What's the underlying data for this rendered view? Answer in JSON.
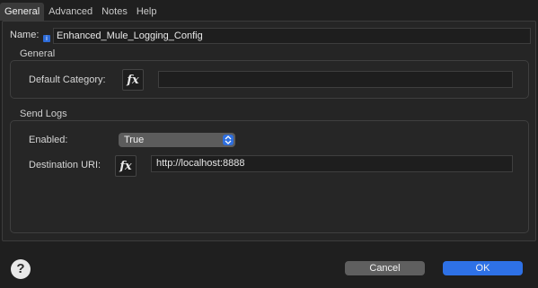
{
  "tabs": [
    {
      "label": "General"
    },
    {
      "label": "Advanced"
    },
    {
      "label": "Notes"
    },
    {
      "label": "Help"
    }
  ],
  "name": {
    "label": "Name:",
    "value": "Enhanced_Mule_Logging_Config",
    "info_icon": "info-icon"
  },
  "general_group": {
    "title": "General",
    "default_category": {
      "label": "Default Category:",
      "fx_label": "fx",
      "value": ""
    }
  },
  "send_logs_group": {
    "title": "Send Logs",
    "enabled": {
      "label": "Enabled:",
      "selected": "True"
    },
    "destination_uri": {
      "label": "Destination URI:",
      "fx_label": "fx",
      "value": "http://localhost:8888"
    }
  },
  "footer": {
    "help_label": "?",
    "cancel_label": "Cancel",
    "ok_label": "OK"
  },
  "colors": {
    "accent": "#2e71e6",
    "background": "#1f1f1f"
  }
}
